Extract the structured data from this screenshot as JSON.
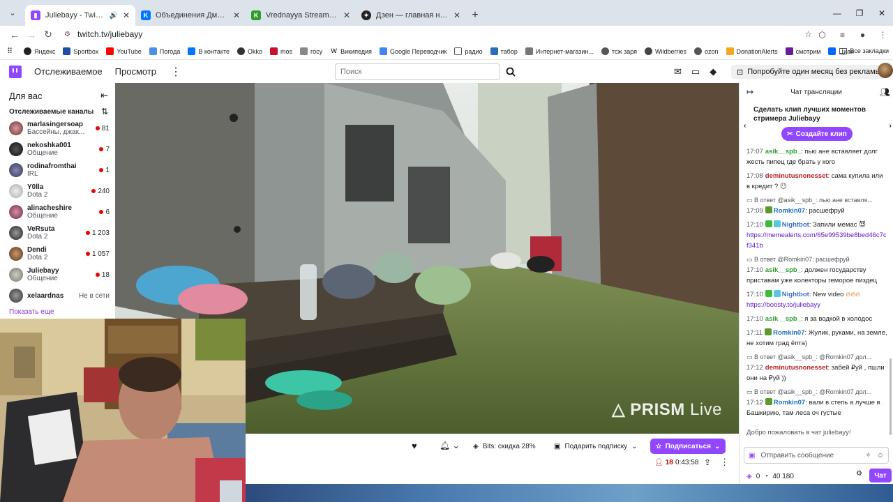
{
  "browser": {
    "tabs": [
      {
        "title": "Juliebayy - Twitch",
        "active": true
      },
      {
        "title": "Объединения Дмитрия Зорин..."
      },
      {
        "title": "Vrednayya Stream - Watch Live..."
      },
      {
        "title": "Дзен — главная новостная и..."
      }
    ],
    "url": "twitch.tv/juliebayy",
    "bookmarks": [
      "Яндекс",
      "Sportbox",
      "YouTube",
      "Погода",
      "В контакте",
      "Okko",
      "mos",
      "госу",
      "Википедия",
      "Google Переводчик",
      "радио",
      "табор",
      "Интернет-магазин...",
      "тсж заря",
      "Wildberries",
      "ozon",
      "DonationAlerts",
      "смотрим",
      "Циан"
    ],
    "bookmarks_all": "Все закладки"
  },
  "twitch_nav": {
    "following": "Отслеживаемое",
    "browse": "Просмотр",
    "search_placeholder": "Поиск",
    "promo": "Попробуйте один месяц без рекламы"
  },
  "sidebar": {
    "title": "Для вас",
    "section": "Отслеживаемые каналы",
    "channels": [
      {
        "name": "marlasingersoap",
        "category": "Бассейны, джак...",
        "viewers": "81"
      },
      {
        "name": "nekoshka001",
        "category": "Общение",
        "viewers": "7"
      },
      {
        "name": "rodinafromthai",
        "category": "IRL",
        "viewers": "1"
      },
      {
        "name": "Y0lla",
        "category": "Dota 2",
        "viewers": "240"
      },
      {
        "name": "alinacheshire",
        "category": "Общение",
        "viewers": "6"
      },
      {
        "name": "VeRsuta",
        "category": "Dota 2",
        "viewers": "1 203"
      },
      {
        "name": "Dendi",
        "category": "Dota 2",
        "viewers": "1 057"
      },
      {
        "name": "Juliebayy",
        "category": "Общение",
        "viewers": "18"
      },
      {
        "name": "xelaardnas",
        "category": "",
        "viewers": "Не в сети"
      }
    ],
    "show_more": "Показать еще"
  },
  "video": {
    "watermark_bold": "PRISM",
    "watermark_light": " Live"
  },
  "below_video": {
    "bits": "Bits: скидка 28%",
    "gift": "Подарить подписку",
    "subscribe": "Подписаться",
    "viewers": "18",
    "uptime": "0:43:58"
  },
  "chat": {
    "title": "Чат трансляции",
    "clip_text": "Сделать клип лучших моментов стримера Juliebayy",
    "clip_button": "Создайте клип",
    "messages": [
      {
        "time": "17:07",
        "user": "asik__spb_",
        "color": "#2e9c2e",
        "text": ": пью ане вставляет долг жесть пипец где брать у кого"
      },
      {
        "time": "17:08",
        "user": "deminutusnonesset",
        "color": "#b22222",
        "text": ": сама купила или в кредит ?"
      },
      {
        "reply": "В ответ @asik__spb_: пью ане вставля...",
        "time": "17:09",
        "user": "Romkin07",
        "color": "#1e6fc2",
        "text": ": расшефруй"
      },
      {
        "time": "17:10",
        "user": "Nightbot",
        "color": "#3b6fd1",
        "text": ": Запили мемас",
        "link": "https://memealerts.com/65e99539be8bed46c7cf341b"
      },
      {
        "reply": "В ответ @Romkin07: расшефруй",
        "time": "17:10",
        "user": "asik__spb_",
        "color": "#2e9c2e",
        "text": ": должен государству приставам уже колекторы геморое пиздец"
      },
      {
        "time": "17:10",
        "user": "Nightbot",
        "color": "#3b6fd1",
        "text": ": New video",
        "link": "https://boosty.to/juliebayy"
      },
      {
        "time": "17:10",
        "user": "asik__spb_",
        "color": "#2e9c2e",
        "text": ": я за водкой в холодос"
      },
      {
        "time": "17:11",
        "user": "Romkin07",
        "color": "#1e6fc2",
        "text": ": Жулик, руками, на земле, не хотим град ёпта)"
      },
      {
        "reply": "В ответ @asik__spb_: @Romkin07 дол...",
        "time": "17:12",
        "user": "deminutusnonesset",
        "color": "#b22222",
        "text": ": забей ₽уй , пшли они на ₽уй ))"
      },
      {
        "reply": "В ответ @asik__spb_: @Romkin07 дол...",
        "time": "17:12",
        "user": "Romkin07",
        "color": "#1e6fc2",
        "text": ": вали в степь а лучше в Башкирию, там леса оч густые"
      }
    ],
    "welcome": "Добро пожаловать в чат juliebayy!",
    "input_placeholder": "Отправить сообщение",
    "points": "0",
    "channel_points": "40 180",
    "send_label": "Чат"
  }
}
